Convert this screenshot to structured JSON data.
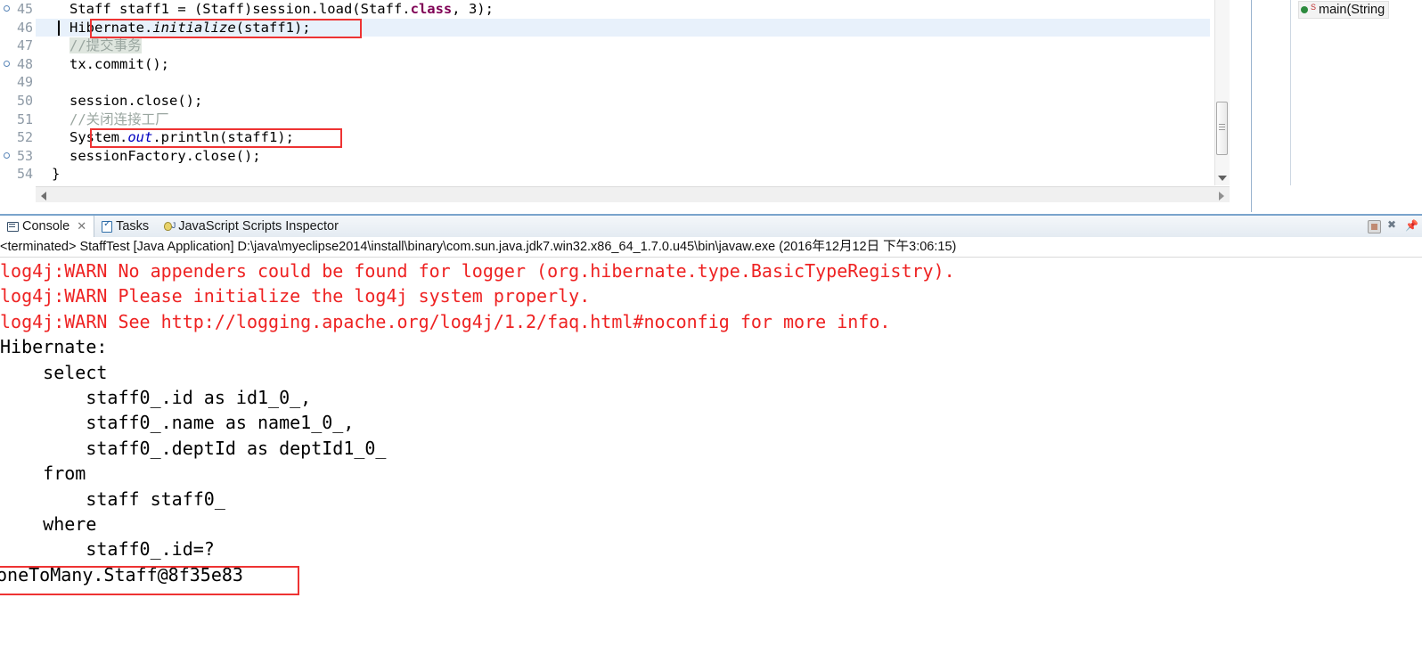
{
  "editor": {
    "lines": [
      {
        "num": "45",
        "marker": true,
        "highlight": false,
        "caret": false,
        "text": "Staff staff1 = (Staff)session.load(Staff.class, 3);"
      },
      {
        "num": "46",
        "marker": false,
        "highlight": true,
        "caret": true,
        "text": "Hibernate.initialize(staff1);"
      },
      {
        "num": "47",
        "marker": false,
        "highlight": false,
        "caret": false,
        "text": "//提交事务"
      },
      {
        "num": "48",
        "marker": true,
        "highlight": false,
        "caret": false,
        "text": "tx.commit();"
      },
      {
        "num": "49",
        "marker": false,
        "highlight": false,
        "caret": false,
        "text": ""
      },
      {
        "num": "50",
        "marker": false,
        "highlight": false,
        "caret": false,
        "text": "session.close();"
      },
      {
        "num": "51",
        "marker": false,
        "highlight": false,
        "caret": false,
        "text": "//关闭连接工厂"
      },
      {
        "num": "52",
        "marker": false,
        "highlight": false,
        "caret": false,
        "text": "System.out.println(staff1);"
      },
      {
        "num": "53",
        "marker": true,
        "highlight": false,
        "caret": false,
        "text": "sessionFactory.close();"
      },
      {
        "num": "54",
        "marker": false,
        "highlight": false,
        "caret": false,
        "text": "}"
      }
    ],
    "line45": {
      "a": "Staff staff1 = (Staff)session.load(Staff.",
      "kw": "class",
      "b": ", 3);"
    },
    "line46": {
      "a": "Hibernate.",
      "m": "initialize",
      "b": "(staff1);"
    },
    "line52": {
      "a": "System.",
      "f": "out",
      "b": ".println(staff1);"
    },
    "comment47": "//提交事务",
    "comment51": "//关闭连接工厂",
    "line48": "tx.commit();",
    "line50": "session.close();",
    "line53": "sessionFactory.close();",
    "line54": "}",
    "highlight_color": "#e8f1fb",
    "annotation_color": "#ee3333"
  },
  "outline": {
    "item_label": "main(String",
    "static_marker": "S"
  },
  "console": {
    "tabs": [
      {
        "label": "Console",
        "icon": "console-icon",
        "active": true,
        "closable": true
      },
      {
        "label": "Tasks",
        "icon": "tasks-icon",
        "active": false,
        "closable": false
      },
      {
        "label": "JavaScript Scripts Inspector",
        "icon": "javascript-icon",
        "active": false,
        "closable": false
      }
    ],
    "close_glyph": "✕",
    "toolbar": [
      {
        "name": "terminate-button"
      },
      {
        "name": "remove-all-terminated-button"
      },
      {
        "name": "pin-console-button"
      }
    ],
    "status_line": "<terminated> StaffTest [Java Application] D:\\java\\myeclipse2014\\install\\binary\\com.sun.java.jdk7.win32.x86_64_1.7.0.u45\\bin\\javaw.exe (2016年12月12日 下午3:06:15)",
    "output_lines": [
      {
        "text": "log4j:WARN No appenders could be found for logger (org.hibernate.type.BasicTypeRegistry).",
        "error": true
      },
      {
        "text": "log4j:WARN Please initialize the log4j system properly.",
        "error": true
      },
      {
        "text": "log4j:WARN See http://logging.apache.org/log4j/1.2/faq.html#noconfig for more info.",
        "error": true
      },
      {
        "text": "Hibernate: ",
        "error": false
      },
      {
        "text": "    select",
        "error": false
      },
      {
        "text": "        staff0_.id as id1_0_,",
        "error": false
      },
      {
        "text": "        staff0_.name as name1_0_,",
        "error": false
      },
      {
        "text": "        staff0_.deptId as deptId1_0_",
        "error": false
      },
      {
        "text": "    from",
        "error": false
      },
      {
        "text": "        staff staff0_",
        "error": false
      },
      {
        "text": "    where",
        "error": false
      },
      {
        "text": "        staff0_.id=?",
        "error": false
      },
      {
        "text": "oneToMany.Staff@8f35e83",
        "error": false
      }
    ],
    "error_color": "#ee2222"
  }
}
